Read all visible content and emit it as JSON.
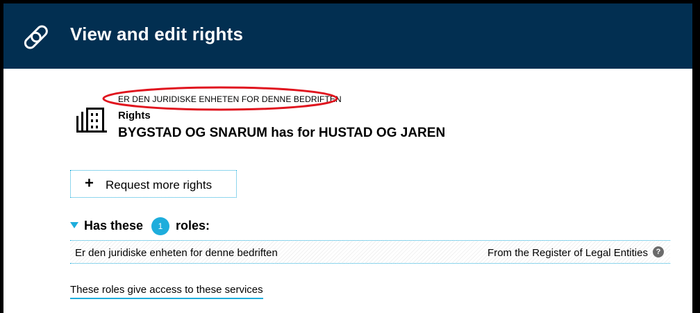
{
  "colors": {
    "header_bg": "#022f51",
    "accent": "#1eaddc",
    "highlight_annotation": "#e0141e",
    "help_icon_bg": "#6a6a6a"
  },
  "header": {
    "icon": "link-icon",
    "title": "View and edit rights"
  },
  "entity": {
    "icon": "building-icon",
    "caption": "ER DEN JURIDISKE ENHETEN FOR DENNE BEDRIFTEN",
    "label": "Rights",
    "subtitle": "BYGSTAD OG SNARUM has for HUSTAD OG JAREN"
  },
  "request_button": {
    "icon": "plus-icon",
    "label": "Request more rights"
  },
  "roles": {
    "heading_prefix": "Has these",
    "count": "1",
    "heading_suffix": "roles:",
    "items": [
      {
        "name": "Er den juridiske enheten for denne bedriften",
        "source": "From the Register of Legal Entities",
        "help_icon": "question-icon",
        "help_symbol": "?"
      }
    ]
  },
  "services_link": {
    "label": "These roles give access to these services"
  }
}
